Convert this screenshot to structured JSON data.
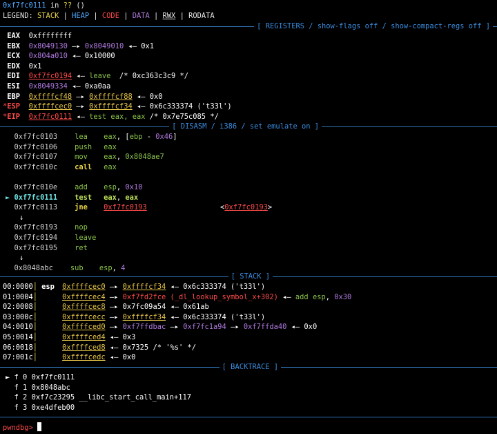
{
  "header": {
    "addr": "0xf7fc0111",
    "in_text": " in ",
    "func": "??",
    "args": " ()"
  },
  "legend": {
    "label": "LEGEND: ",
    "stack": "STACK",
    "heap": "HEAP",
    "code": "CODE",
    "data": "DATA",
    "rwx": "RWX",
    "rodata": "RODATA",
    "sep": " | "
  },
  "sections": {
    "registers": "[ REGISTERS / show-flags off / show-compact-regs off ]",
    "disasm": "[ DISASM / i386 / set emulate on ]",
    "stack": "[ STACK ]",
    "backtrace": "[ BACKTRACE ]"
  },
  "registers": [
    {
      "mark": " ",
      "name": "EAX",
      "parts": [
        [
          "0xffffffff",
          "white"
        ]
      ]
    },
    {
      "mark": " ",
      "name": "EBX",
      "parts": [
        [
          "0x8049130",
          "purple"
        ],
        [
          " —▸ ",
          "white"
        ],
        [
          "0x8049010",
          "purple"
        ],
        [
          " ◂— 0x1",
          "white"
        ]
      ]
    },
    {
      "mark": " ",
      "name": "ECX",
      "parts": [
        [
          "0x804a010",
          "purple"
        ],
        [
          " ◂— 0x10000",
          "white"
        ]
      ]
    },
    {
      "mark": " ",
      "name": "EDX",
      "parts": [
        [
          "0x1",
          "white"
        ]
      ]
    },
    {
      "mark": " ",
      "name": "EDI",
      "parts": [
        [
          "0xf7fc0194",
          "red-u"
        ],
        [
          " ◂— ",
          "white"
        ],
        [
          "leave",
          "green"
        ],
        [
          "  /* 0xc363c3c9 */",
          "white"
        ]
      ]
    },
    {
      "mark": " ",
      "name": "ESI",
      "parts": [
        [
          "0x8049334",
          "purple"
        ],
        [
          " ◂— 0xa0aa",
          "white"
        ]
      ]
    },
    {
      "mark": " ",
      "name": "EBP",
      "parts": [
        [
          "0xffffcf48",
          "yel-u"
        ],
        [
          " —▸ ",
          "white"
        ],
        [
          "0xffffcf88",
          "yel-u"
        ],
        [
          " ◂— 0x0",
          "white"
        ]
      ]
    },
    {
      "mark": "*",
      "name": "ESP",
      "parts": [
        [
          "0xffffcec0",
          "yel-u"
        ],
        [
          " —▸ ",
          "white"
        ],
        [
          "0xffffcf34",
          "yel-u"
        ],
        [
          " ◂— 0x6c333374 ('t33l')",
          "white"
        ]
      ]
    },
    {
      "mark": "*",
      "name": "EIP",
      "parts": [
        [
          "0xf7fc0111",
          "red-u"
        ],
        [
          " ◂— ",
          "white"
        ],
        [
          "test eax, eax",
          "green"
        ],
        [
          " /* 0x7e75c085 */",
          "white"
        ]
      ]
    }
  ],
  "disasm": [
    {
      "arrow": " ",
      "addr": "0xf7fc0103",
      "mn": "lea",
      "ops": [
        [
          "eax",
          "green"
        ],
        [
          ", [",
          "white"
        ],
        [
          "ebp",
          "green"
        ],
        [
          " - ",
          "white"
        ],
        [
          "0x46",
          "purple"
        ],
        [
          "]",
          "white"
        ]
      ],
      "cur": false
    },
    {
      "arrow": " ",
      "addr": "0xf7fc0106",
      "mn": "push",
      "ops": [
        [
          "eax",
          "green"
        ]
      ],
      "cur": false
    },
    {
      "arrow": " ",
      "addr": "0xf7fc0107",
      "mn": "mov",
      "ops": [
        [
          "eax",
          "green"
        ],
        [
          ", ",
          "white"
        ],
        [
          "0x8048ae7",
          "green"
        ]
      ],
      "cur": false
    },
    {
      "arrow": " ",
      "addr": "0xf7fc010c",
      "mn": "call",
      "ops": [
        [
          "eax",
          "green"
        ]
      ],
      "cur": false,
      "bold": true
    },
    {
      "blank": true
    },
    {
      "arrow": " ",
      "addr": "0xf7fc010e",
      "mn": "add",
      "ops": [
        [
          "esp",
          "green"
        ],
        [
          ", ",
          "white"
        ],
        [
          "0x10",
          "purple"
        ]
      ],
      "cur": false
    },
    {
      "arrow": "►",
      "addr": "0xf7fc0111",
      "mn": "test",
      "ops": [
        [
          "eax",
          "greenb"
        ],
        [
          ", ",
          "white"
        ],
        [
          "eax",
          "greenb"
        ]
      ],
      "cur": true
    },
    {
      "arrow": " ",
      "addr": "0xf7fc0113",
      "mn": "jne",
      "ops": [
        [
          "0xf7fc0193",
          "red-u"
        ],
        [
          "                 <",
          "white"
        ],
        [
          "0xf7fc0193",
          "red-u"
        ],
        [
          ">",
          "white"
        ]
      ],
      "cur": false,
      "bold": true
    },
    {
      "down": "↓"
    },
    {
      "arrow": " ",
      "addr": "0xf7fc0193",
      "mn": "nop",
      "ops": [],
      "cur": false
    },
    {
      "arrow": " ",
      "addr": "0xf7fc0194",
      "mn": "leave",
      "ops": [],
      "cur": false
    },
    {
      "arrow": " ",
      "addr": "0xf7fc0195",
      "mn": "ret",
      "ops": [],
      "cur": false
    },
    {
      "down": "↓"
    },
    {
      "arrow": " ",
      "addr": "0x8048abc",
      "mn": "sub",
      "ops": [
        [
          "esp",
          "green"
        ],
        [
          ", ",
          "white"
        ],
        [
          "4",
          "purple"
        ]
      ],
      "cur": false
    }
  ],
  "stack": [
    {
      "idx": "00:0000",
      "reg": "esp",
      "parts": [
        [
          "0xffffcec0",
          "yel-u"
        ],
        [
          " —▸ ",
          "white"
        ],
        [
          "0xffffcf34",
          "yel-u"
        ],
        [
          " ◂— 0x6c333374 ('t33l')",
          "white"
        ]
      ]
    },
    {
      "idx": "01:0004",
      "reg": "",
      "parts": [
        [
          "0xffffcec4",
          "yel-u"
        ],
        [
          " —▸ ",
          "white"
        ],
        [
          "0xf7fd2fce (_dl_lookup_symbol_x+302)",
          "red"
        ],
        [
          " ◂— ",
          "white"
        ],
        [
          "add ",
          "green"
        ],
        [
          "esp",
          "green"
        ],
        [
          ", ",
          "white"
        ],
        [
          "0x30",
          "purple"
        ]
      ]
    },
    {
      "idx": "02:0008",
      "reg": "",
      "parts": [
        [
          "0xffffcec8",
          "yel-u"
        ],
        [
          " —▸ 0x7fc09a54 ◂— 0x61ab",
          "white"
        ]
      ]
    },
    {
      "idx": "03:000c",
      "reg": "",
      "parts": [
        [
          "0xffffcecc",
          "yel-u"
        ],
        [
          " —▸ ",
          "white"
        ],
        [
          "0xffffcf34",
          "yel-u"
        ],
        [
          " ◂— 0x6c333374 ('t33l')",
          "white"
        ]
      ]
    },
    {
      "idx": "04:0010",
      "reg": "",
      "parts": [
        [
          "0xffffced0",
          "yel-u"
        ],
        [
          " —▸ ",
          "white"
        ],
        [
          "0xf7ffdbac",
          "purple"
        ],
        [
          " —▸ ",
          "white"
        ],
        [
          "0xf7fc1a94",
          "purple"
        ],
        [
          " —▸ ",
          "white"
        ],
        [
          "0xf7ffda40",
          "purple"
        ],
        [
          " ◂— 0x0",
          "white"
        ]
      ]
    },
    {
      "idx": "05:0014",
      "reg": "",
      "parts": [
        [
          "0xffffced4",
          "yel-u"
        ],
        [
          " ◂— 0x3",
          "white"
        ]
      ]
    },
    {
      "idx": "06:0018",
      "reg": "",
      "parts": [
        [
          "0xffffced8",
          "yel-u"
        ],
        [
          " ◂— 0x7325 /* '%s' */",
          "white"
        ]
      ]
    },
    {
      "idx": "07:001c",
      "reg": "",
      "parts": [
        [
          "0xffffcedc",
          "yel-u"
        ],
        [
          " ◂— 0x0",
          "white"
        ]
      ]
    }
  ],
  "backtrace": [
    {
      "mark": "►",
      "frame": "f 0",
      "text": "0xf7fc0111"
    },
    {
      "mark": " ",
      "frame": "f 1",
      "text": "0x8048abc"
    },
    {
      "mark": " ",
      "frame": "f 2",
      "text": "0xf7c23295 __libc_start_call_main+117"
    },
    {
      "mark": " ",
      "frame": "f 3",
      "text": "0xe4dfeb00"
    }
  ],
  "prompt": {
    "text": "pwndbg> "
  },
  "colors": {
    "background": "#000000",
    "separator": "#2f73b4",
    "stack": "#e8c64a",
    "heap": "#4fa8ff",
    "code": "#ff4a4a",
    "data": "#b07ae0",
    "prompt": "#ff4a4a"
  }
}
